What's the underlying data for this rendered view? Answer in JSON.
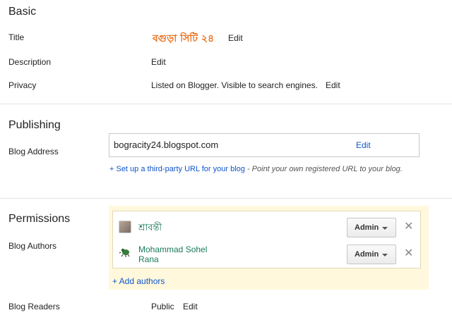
{
  "basic": {
    "heading": "Basic",
    "title_label": "Title",
    "title_value": "বগুড়া সিটি ২৪",
    "title_edit": "Edit",
    "description_label": "Description",
    "description_edit": "Edit",
    "privacy_label": "Privacy",
    "privacy_value": "Listed on Blogger. Visible to search engines.",
    "privacy_edit": "Edit"
  },
  "publishing": {
    "heading": "Publishing",
    "blog_address_label": "Blog Address",
    "blog_address_value": "bogracity24.blogspot.com",
    "blog_address_edit": "Edit",
    "third_party_link": "+ Set up a third-party URL for your blog",
    "third_party_note": " - Point your own registered URL to your blog."
  },
  "permissions": {
    "heading": "Permissions",
    "blog_authors_label": "Blog Authors",
    "authors": [
      {
        "name": "শ্রাবন্তী",
        "role": "Admin",
        "avatar_icon": "user-photo-icon"
      },
      {
        "name_line1": "Mohammad Sohel",
        "name_line2": "Rana",
        "role": "Admin",
        "avatar_icon": "blogger-default-avatar-icon"
      }
    ],
    "add_authors": "+ Add authors",
    "blog_readers_label": "Blog Readers",
    "blog_readers_value": "Public",
    "blog_readers_edit": "Edit"
  }
}
